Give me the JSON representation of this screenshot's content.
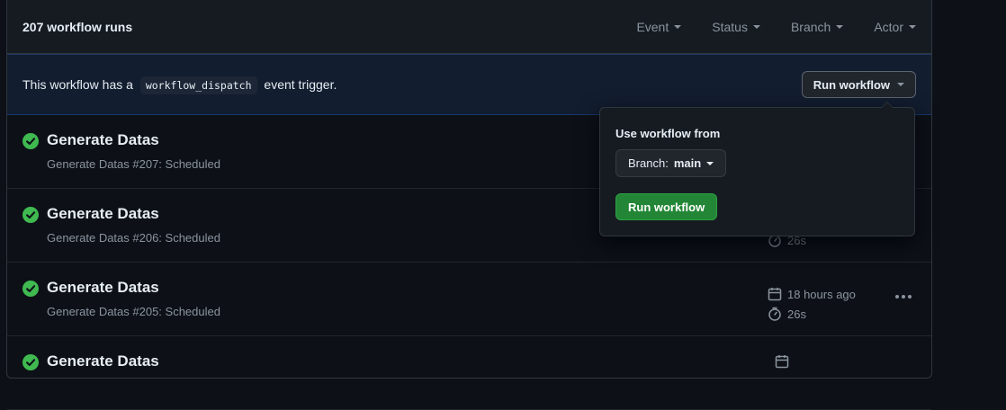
{
  "header": {
    "title": "207 workflow runs",
    "filters": [
      {
        "label": "Event"
      },
      {
        "label": "Status"
      },
      {
        "label": "Branch"
      },
      {
        "label": "Actor"
      }
    ]
  },
  "banner": {
    "text_before": "This workflow has a",
    "code": "workflow_dispatch",
    "text_after": "event trigger.",
    "button_label": "Run workflow"
  },
  "runs": [
    {
      "name": "Generate Datas",
      "subtitle": "Generate Datas #207: Scheduled",
      "time": "",
      "duration": ""
    },
    {
      "name": "Generate Datas",
      "subtitle": "Generate Datas #206: Scheduled",
      "time": "",
      "duration": "26s"
    },
    {
      "name": "Generate Datas",
      "subtitle": "Generate Datas #205: Scheduled",
      "time": "18 hours ago",
      "duration": "26s"
    },
    {
      "name": "Generate Datas",
      "subtitle": "",
      "time": "",
      "duration": ""
    }
  ],
  "popover": {
    "label": "Use workflow from",
    "branch_prefix": "Branch:",
    "branch_value": "main",
    "run_button": "Run workflow"
  },
  "colors": {
    "success": "#3fb950",
    "primary_button": "#238636"
  },
  "icons": {
    "status": "check-circle-icon",
    "time": "calendar-icon",
    "duration": "stopwatch-icon",
    "more": "kebab-horizontal-icon"
  }
}
